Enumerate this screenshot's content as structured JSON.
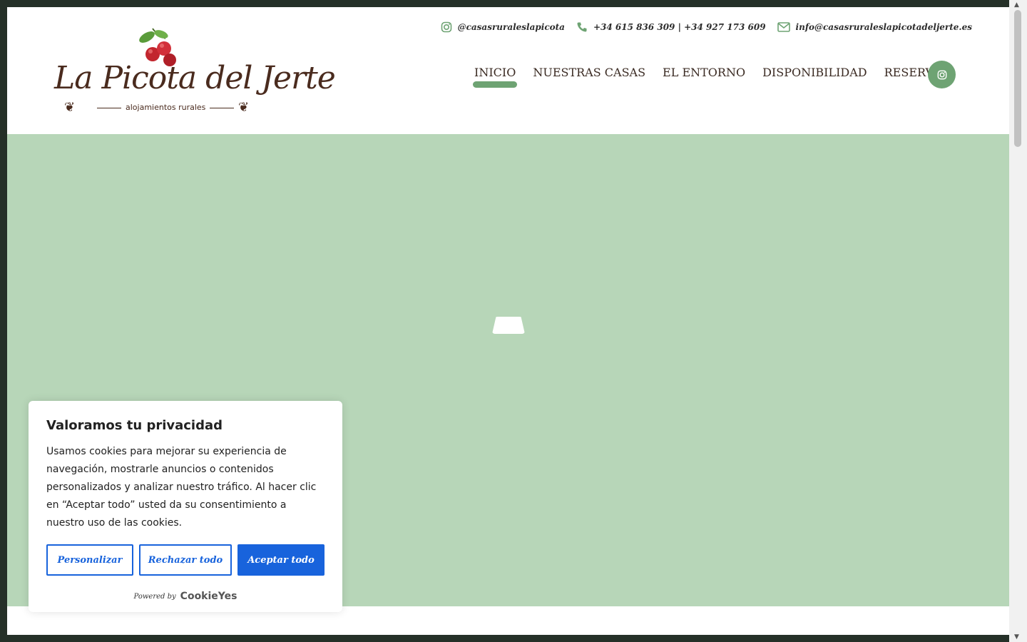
{
  "topbar": {
    "instagram_handle": "@casasruraleslapicota",
    "phone": "+34 615 836 309 | +34 927 173 609",
    "email": "info@casasruraleslapicotadeljerte.es"
  },
  "logo": {
    "brand": "La Picota del Jerte",
    "tagline": "alojamientos rurales"
  },
  "nav": {
    "items": [
      {
        "label": "INICIO",
        "active": true
      },
      {
        "label": "NUESTRAS CASAS"
      },
      {
        "label": "EL ENTORNO"
      },
      {
        "label": "DISPONIBILIDAD"
      },
      {
        "label": "RESERVAR"
      }
    ],
    "instagram_icon": "instagram-icon"
  },
  "colors": {
    "accent_green": "#6ea373",
    "hero_bg": "#b7d6b8",
    "brand_brown": "#4a2b1e",
    "cookie_blue": "#1863dc"
  },
  "cookie": {
    "title": "Valoramos tu privacidad",
    "body": "Usamos cookies para mejorar su experiencia de navegación, mostrarle anuncios o contenidos personalizados y analizar nuestro tráfico. Al hacer clic en “Aceptar todo” usted da su consentimiento a nuestro uso de las cookies.",
    "customize_label": "Personalizar",
    "reject_label": "Rechazar todo",
    "accept_label": "Aceptar todo",
    "powered_by": "Powered by",
    "powered_brand": "CookieYes"
  }
}
